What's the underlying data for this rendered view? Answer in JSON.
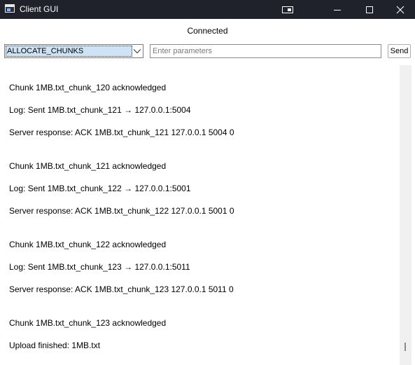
{
  "window": {
    "title": "Client GUI",
    "icon": "window-app-icon",
    "controls": [
      "media-icon",
      "minimize-icon",
      "maximize-icon",
      "close-icon"
    ]
  },
  "status": {
    "text": "Connected"
  },
  "controls": {
    "command_value": "ALLOCATE_CHUNKS",
    "params_placeholder": "Enter parameters",
    "params_value": "",
    "send_label": "Send"
  },
  "log": {
    "lines": [
      "Chunk 1MB.txt_chunk_120 acknowledged",
      "Log: Sent 1MB.txt_chunk_121 → 127.0.0.1:5004",
      "Server response: ACK 1MB.txt_chunk_121 127.0.0.1 5004 0",
      "Chunk 1MB.txt_chunk_121 acknowledged",
      "Log: Sent 1MB.txt_chunk_122 → 127.0.0.1:5001",
      "Server response: ACK 1MB.txt_chunk_122 127.0.0.1 5001 0",
      "Chunk 1MB.txt_chunk_122 acknowledged",
      "Log: Sent 1MB.txt_chunk_123 → 127.0.0.1:5011",
      "Server response: ACK 1MB.txt_chunk_123 127.0.0.1 5011 0",
      "Chunk 1MB.txt_chunk_123 acknowledged",
      "Upload finished: 1MB.txt"
    ]
  },
  "colors": {
    "titlebar_bg": "#20222b",
    "selection_bg": "#cfe3f6",
    "scrollbar_bg": "#f0f0f0"
  }
}
